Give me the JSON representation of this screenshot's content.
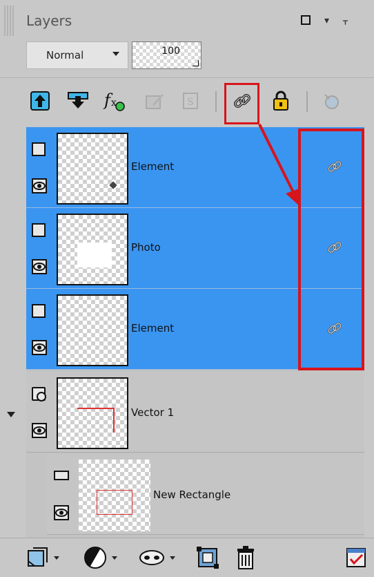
{
  "panel": {
    "title": "Layers"
  },
  "blend_mode": {
    "value": "Normal"
  },
  "opacity": {
    "value": "100"
  },
  "toolbar": {
    "icons": [
      "move-layer-up-icon",
      "move-layer-down-icon",
      "layer-styles-icon",
      "edit-selection-icon",
      "highlight-icon",
      "link-layers-icon",
      "lock-icon",
      "layer-visibility-toggle-icon"
    ]
  },
  "layers": [
    {
      "name": "Element",
      "selected": true,
      "linked": true
    },
    {
      "name": "Photo",
      "selected": true,
      "linked": true
    },
    {
      "name": "Element",
      "selected": true,
      "linked": true
    },
    {
      "name": "Vector 1",
      "selected": false,
      "group": true
    },
    {
      "name": "New Rectangle",
      "selected": false,
      "child": true
    }
  ],
  "colors": {
    "selection": "#3a95f1",
    "highlight": "#d8141b",
    "panel": "#c8c8c8"
  }
}
